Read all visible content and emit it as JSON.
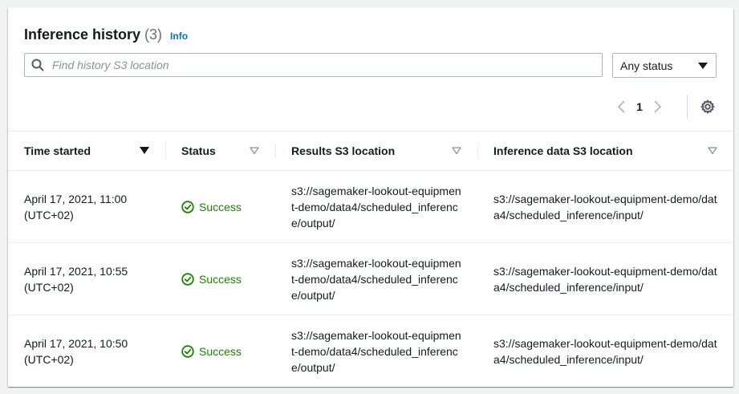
{
  "header": {
    "title": "Inference history",
    "count": "(3)",
    "info_label": "Info"
  },
  "search": {
    "placeholder": "Find history S3 location",
    "icon": "search-icon"
  },
  "status_filter": {
    "selected": "Any status"
  },
  "pagination": {
    "current_page": "1"
  },
  "table": {
    "columns": [
      {
        "label": "Time started"
      },
      {
        "label": "Status"
      },
      {
        "label": "Results S3 location"
      },
      {
        "label": "Inference data S3 location"
      }
    ],
    "rows": [
      {
        "time": "April 17, 2021, 11:00",
        "tz": "(UTC+02)",
        "status": "Success",
        "results": "s3://sagemaker-lookout-equipment-demo/data4/scheduled_inference/output/",
        "input": "s3://sagemaker-lookout-equipment-demo/data4/scheduled_inference/input/"
      },
      {
        "time": "April 17, 2021, 10:55",
        "tz": "(UTC+02)",
        "status": "Success",
        "results": "s3://sagemaker-lookout-equipment-demo/data4/scheduled_inference/output/",
        "input": "s3://sagemaker-lookout-equipment-demo/data4/scheduled_inference/input/"
      },
      {
        "time": "April 17, 2021, 10:50",
        "tz": "(UTC+02)",
        "status": "Success",
        "results": "s3://sagemaker-lookout-equipment-demo/data4/scheduled_inference/output/",
        "input": "s3://sagemaker-lookout-equipment-demo/data4/scheduled_inference/input/"
      }
    ]
  },
  "colors": {
    "accent_link": "#0073bb",
    "success": "#1d8102",
    "text": "#16191f",
    "muted": "#687078",
    "border": "#aab7b8"
  }
}
